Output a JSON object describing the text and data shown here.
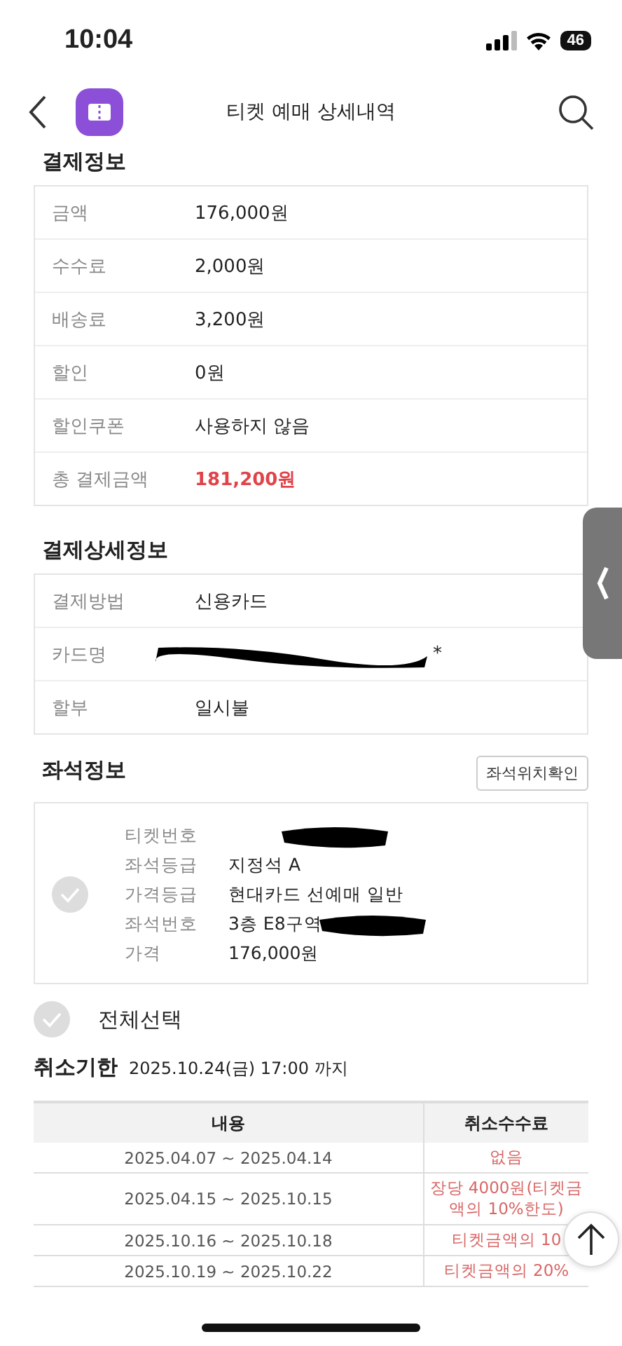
{
  "status_bar": {
    "time": "10:04",
    "battery": "46"
  },
  "nav": {
    "title": "티켓 예매 상세내역"
  },
  "payment": {
    "title": "결제정보",
    "rows": [
      {
        "label": "금액",
        "value": "176,000원",
        "kind": "plain"
      },
      {
        "label": "수수료",
        "value": "2,000원",
        "kind": "plain"
      },
      {
        "label": "배송료",
        "value": "3,200원",
        "kind": "plain"
      },
      {
        "label": "할인",
        "value": "0원",
        "kind": "plain"
      },
      {
        "label": "할인쿠폰",
        "value": "사용하지 않음",
        "kind": "plain"
      },
      {
        "label": "총 결제금액",
        "value": "181,200원",
        "kind": "total"
      }
    ]
  },
  "payment_detail": {
    "title": "결제상세정보",
    "rows": [
      {
        "label": "결제방법",
        "value": "신용카드",
        "kind": "plain"
      },
      {
        "label": "카드명",
        "value": "*",
        "kind": "redacted"
      },
      {
        "label": "할부",
        "value": "일시불",
        "kind": "plain"
      }
    ]
  },
  "seat": {
    "title": "좌석정보",
    "button": "좌석위치확인",
    "checked": false,
    "rows": [
      {
        "label": "티켓번호",
        "kind": "redacted"
      },
      {
        "label": "좌석등급",
        "value": "지정석 A",
        "kind": "plain"
      },
      {
        "label": "가격등급",
        "value": "현대카드 선예매 일반",
        "kind": "plain"
      },
      {
        "label": "좌석번호",
        "value": "3층 E8구역",
        "kind": "redacted"
      },
      {
        "label": "가격",
        "value": "176,000원",
        "kind": "plain"
      }
    ]
  },
  "select_all": {
    "label": "전체선택",
    "checked": false
  },
  "cancel": {
    "title": "취소기한",
    "deadline": "2025.10.24(금) 17:00 까지",
    "columns": [
      "내용",
      "취소수수료"
    ],
    "rows": [
      {
        "period": "2025.04.07 ~ 2025.04.14",
        "fee": "없음"
      },
      {
        "period": "2025.04.15 ~ 2025.10.15",
        "fee": "장당 4000원(티켓금액의 10%한도)"
      },
      {
        "period": "2025.10.16 ~ 2025.10.18",
        "fee": "티켓금액의 10"
      },
      {
        "period": "2025.10.19 ~ 2025.10.22",
        "fee": "티켓금액의 20%"
      }
    ]
  }
}
